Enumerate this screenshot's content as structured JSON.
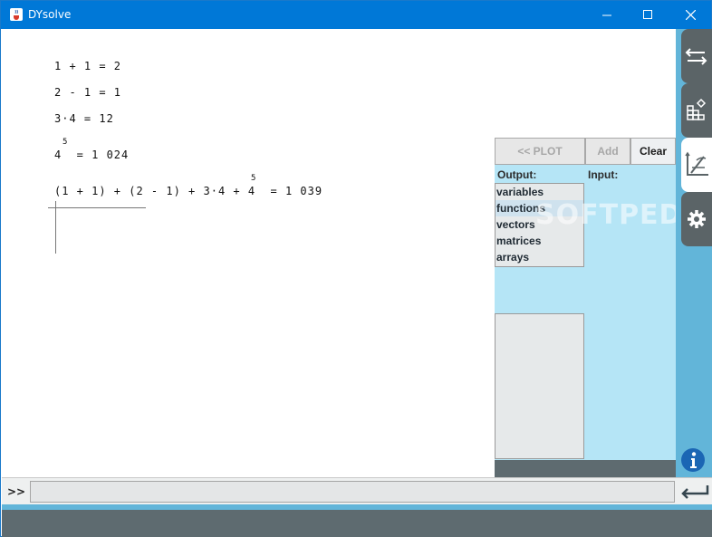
{
  "window": {
    "title": "DYsolve",
    "icon": "java-cup-icon"
  },
  "worksheet": {
    "lines": [
      "1 + 1 = 2",
      "2 - 1 = 1",
      "3·4 = 12",
      "4  = 1 024",
      "(1 + 1) + (2 - 1) + 3·4 + 4  = 1 039"
    ],
    "superscripts": [
      "5",
      "5"
    ]
  },
  "panel": {
    "plot_label": "<<   PLOT",
    "add_label": "Add",
    "clear_label": "Clear",
    "output_label": "Output:",
    "input_label": "Input:",
    "output_items": [
      "variables",
      "functions",
      "vectors",
      "matrices",
      "arrays"
    ],
    "selected_item": "functions"
  },
  "sidebar": {
    "tabs": [
      "arrows-icon",
      "grid-shapes-icon",
      "plot-axes-icon",
      "gear-icon"
    ],
    "active_tab": "plot-axes-icon",
    "info_icon": "info-icon"
  },
  "command": {
    "prompt": ">>",
    "value": ""
  },
  "watermark": "SOFTPEDIA",
  "colors": {
    "titlebar": "#0078d7",
    "panel": "#b5e5f6",
    "sidebar": "#62b5d9",
    "dark": "#5e6b70"
  }
}
